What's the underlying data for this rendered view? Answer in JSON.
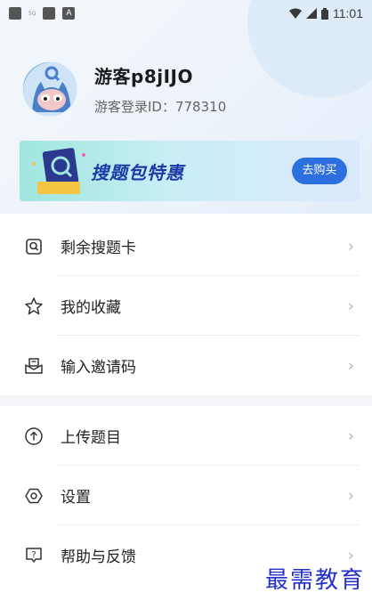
{
  "status_bar": {
    "network_label": "5G",
    "indicator_a": "A",
    "time": "11:01"
  },
  "profile": {
    "username": "游客p8jIJO",
    "user_id": "游客登录ID：778310"
  },
  "banner": {
    "title": "搜题包特惠",
    "button_label": "去购买"
  },
  "menu_group_1": [
    {
      "label": "剩余搜题卡",
      "icon": "search-card-icon"
    },
    {
      "label": "我的收藏",
      "icon": "star-icon"
    },
    {
      "label": "输入邀请码",
      "icon": "invite-code-icon"
    }
  ],
  "menu_group_2": [
    {
      "label": "上传题目",
      "icon": "upload-icon"
    },
    {
      "label": "设置",
      "icon": "settings-icon"
    },
    {
      "label": "帮助与反馈",
      "icon": "help-feedback-icon"
    }
  ],
  "watermark": "最需教育",
  "colors": {
    "accent": "#2e6fe0",
    "banner_text": "#1b3aa6",
    "watermark": "#2330c9"
  }
}
